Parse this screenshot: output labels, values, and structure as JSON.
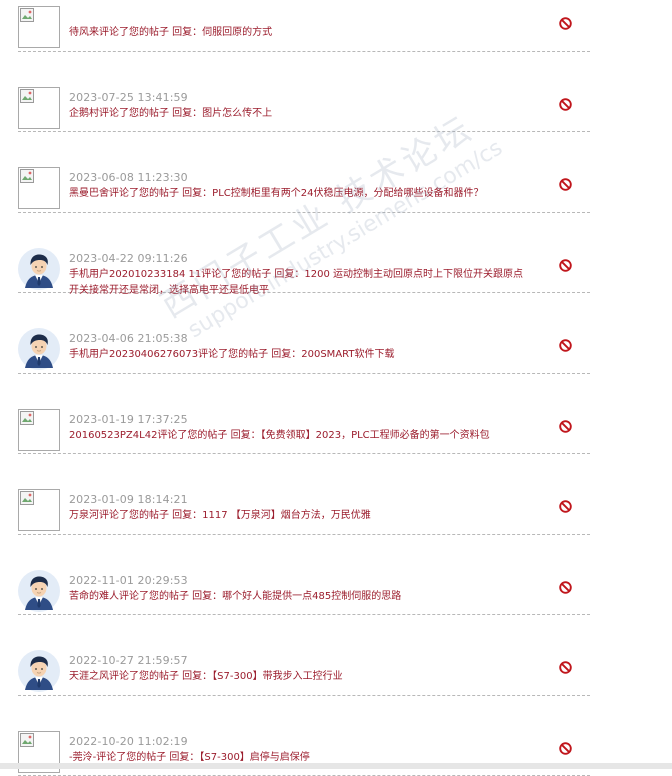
{
  "notifications": [
    {
      "avatar": "broken",
      "time": "",
      "text": "待风来评论了您的帖子 回复：伺服回原的方式"
    },
    {
      "avatar": "broken",
      "time": "2023-07-25 13:41:59",
      "text": "企鹅村评论了您的帖子 回复：图片怎么传不上"
    },
    {
      "avatar": "broken",
      "time": "2023-06-08 11:23:30",
      "text": "黑曼巴舍评论了您的帖子 回复：PLC控制柜里有两个24伏稳压电源，分配给哪些设备和器件？"
    },
    {
      "avatar": "person",
      "time": "2023-04-22 09:11:26",
      "text": "手机用户202010233184 11评论了您的帖子 回复：1200 运动控制主动回原点时上下限位开关跟原点开关接常开还是常闭，选择高电平还是低电平"
    },
    {
      "avatar": "person",
      "time": "2023-04-06 21:05:38",
      "text": "手机用户20230406276073评论了您的帖子 回复：200SMART软件下载"
    },
    {
      "avatar": "broken",
      "time": "2023-01-19 17:37:25",
      "text": "20160523PZ4L42评论了您的帖子 回复：【免费领取】2023，PLC工程师必备的第一个资料包"
    },
    {
      "avatar": "broken",
      "time": "2023-01-09 18:14:21",
      "text": "万泉河评论了您的帖子 回复：1117 【万泉河】烟台方法，万民优雅"
    },
    {
      "avatar": "person",
      "time": "2022-11-01 20:29:53",
      "text": "苦命的难人评论了您的帖子 回复：哪个好人能提供一点485控制伺服的思路"
    },
    {
      "avatar": "person",
      "time": "2022-10-27 21:59:57",
      "text": "天涯之风评论了您的帖子 回复：【S7-300】带我步入工控行业"
    },
    {
      "avatar": "broken",
      "time": "2022-10-20 11:02:19",
      "text": "-莞泠-评论了您的帖子 回复：【S7-300】启停与启保停"
    }
  ],
  "icons": {
    "delete": "prohibit-icon",
    "broken_image": "broken-image-icon",
    "avatar": "person-avatar-icon"
  },
  "colors": {
    "comment_text": "#9b1c2c",
    "timestamp": "#9a9a9a",
    "delete_icon": "#c0161c",
    "divider": "#b8b8b8"
  },
  "watermark": {
    "line1": "西门子工业 技术论坛",
    "line2": "support.industry.siemens.com/cs"
  }
}
